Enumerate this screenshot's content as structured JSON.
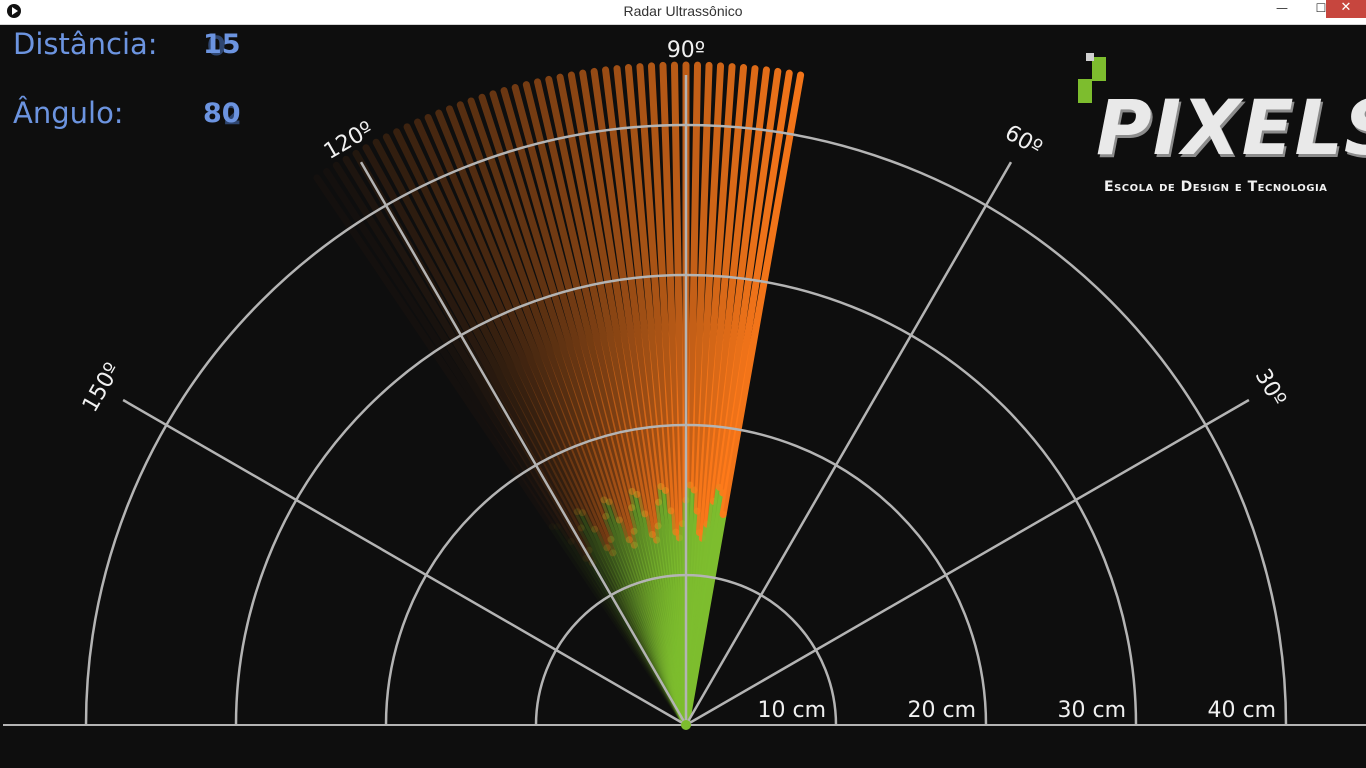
{
  "window": {
    "title": "Radar Ultrassônico",
    "controls": {
      "minimize": "—",
      "maximize": "☐",
      "close": "✕"
    }
  },
  "readouts": {
    "distance_label": "Distância:",
    "distance_value": "15",
    "distance_overlap": "0",
    "angle_label": "Ângulo:",
    "angle_value": "80",
    "angle_overlap": "2"
  },
  "radar": {
    "angle_labels": [
      "30º",
      "60º",
      "90º",
      "120º",
      "150º"
    ],
    "range_labels": [
      "10 cm",
      "20 cm",
      "30 cm",
      "40 cm"
    ],
    "max_range_cm": 40,
    "sweep": {
      "direction": "counter-clockwise",
      "current_angle_deg": 80,
      "trail_start_deg": 124,
      "detection_distance_cm": 15
    }
  },
  "colors": {
    "background": "#0e0e0e",
    "grid": "#b4b4b4",
    "sweep_clear": "#7dbd2e",
    "sweep_object": "#ff7a1a",
    "readout_text": "#6c94e0",
    "close_button": "#c7463e"
  },
  "logo": {
    "word": "PIXELS",
    "tagline": "Escola de Design e Tecnologia"
  }
}
